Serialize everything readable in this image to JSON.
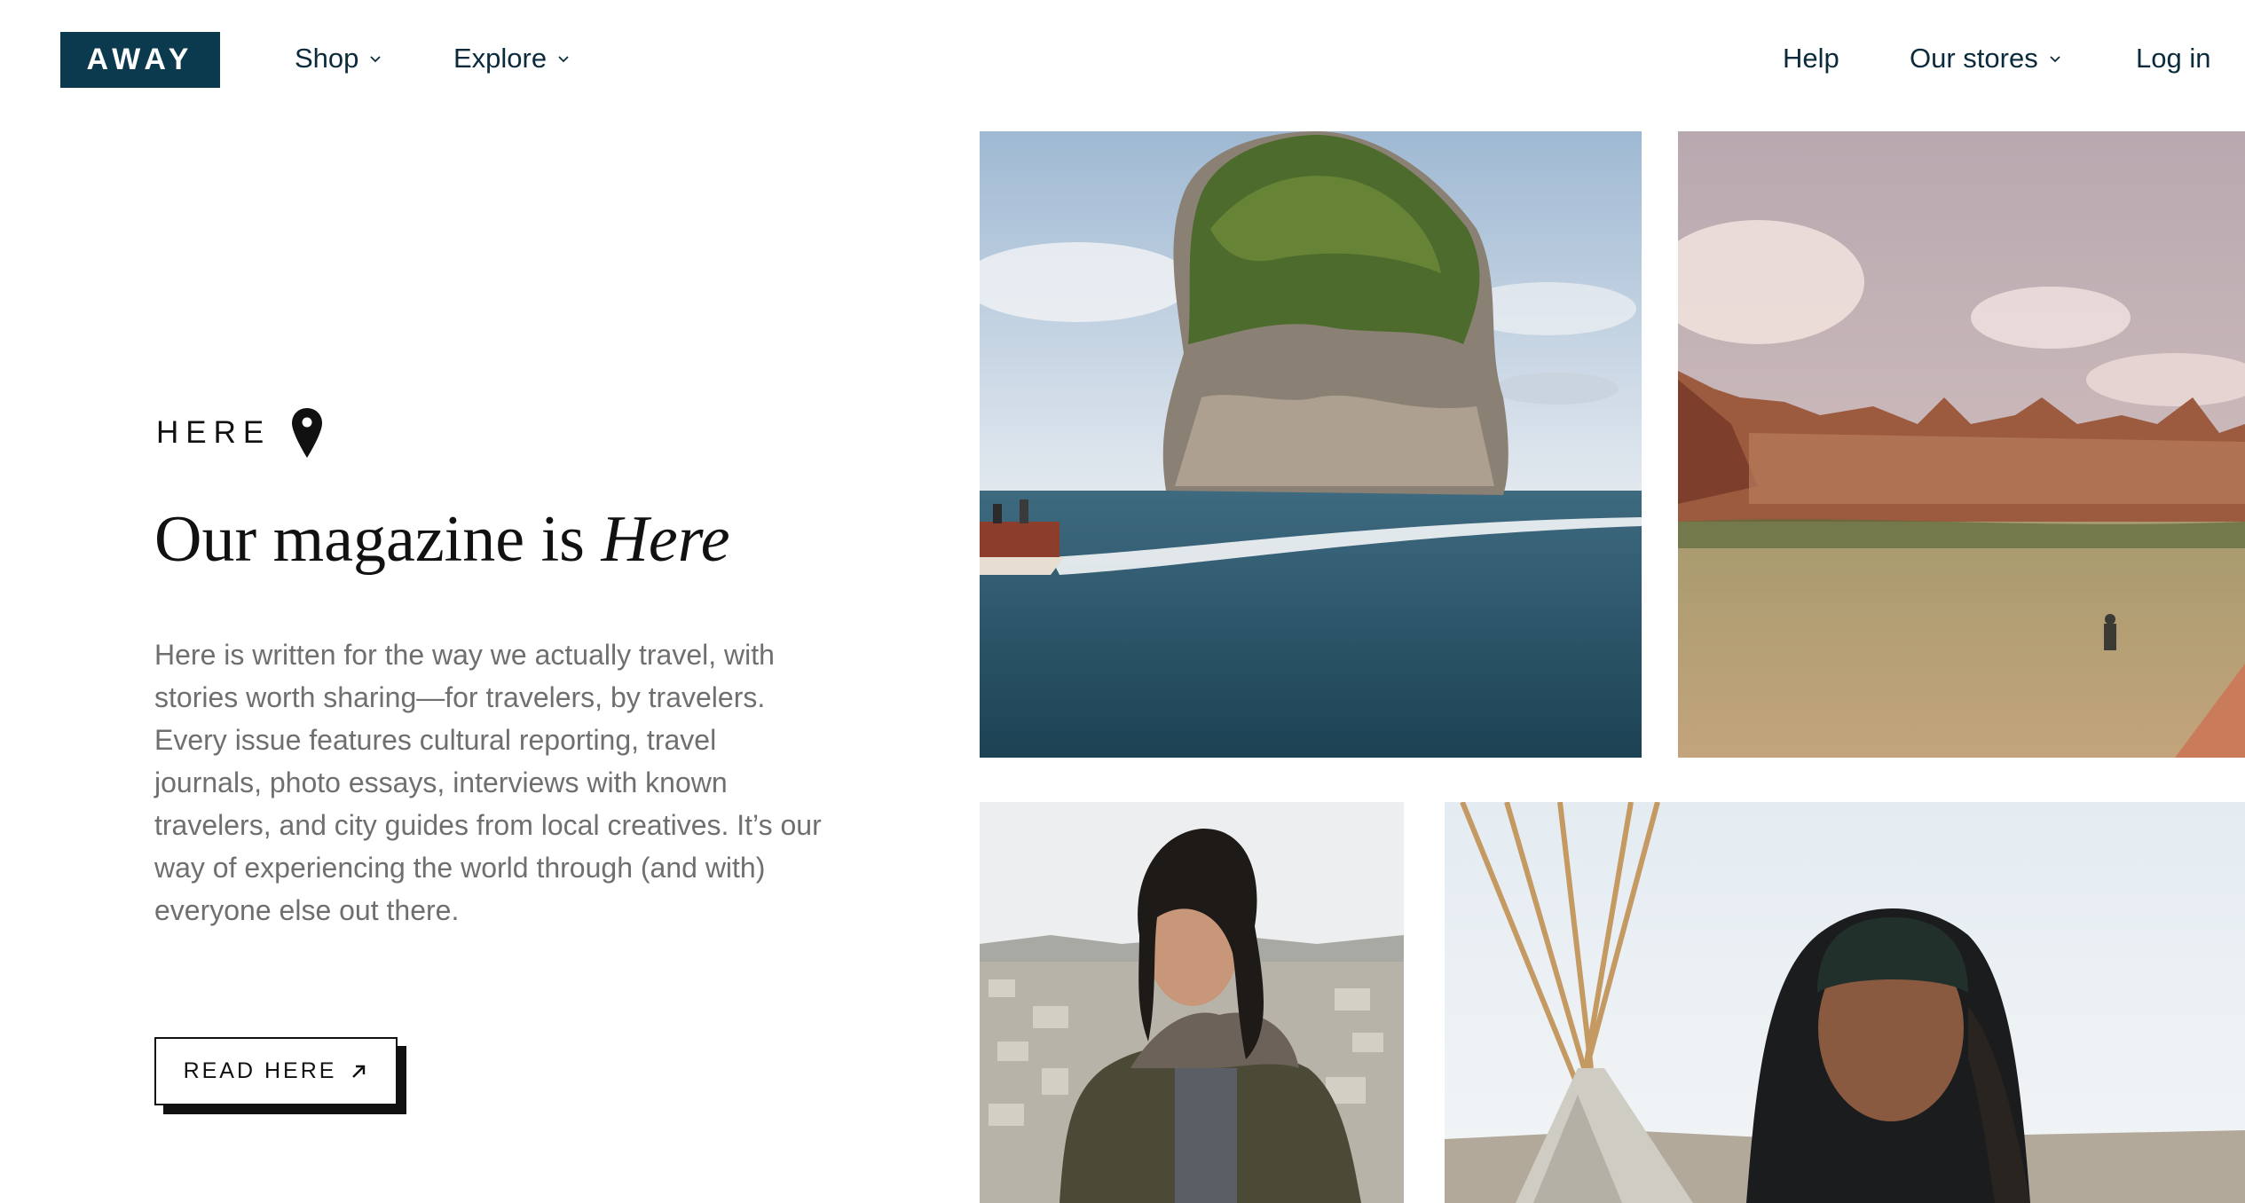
{
  "header": {
    "logo": "AWAY",
    "nav_left": [
      {
        "label": "Shop",
        "icon": "chevron-down-icon"
      },
      {
        "label": "Explore",
        "icon": "chevron-down-icon"
      }
    ],
    "nav_right": [
      {
        "label": "Help"
      },
      {
        "label": "Our stores",
        "icon": "chevron-down-icon"
      },
      {
        "label": "Log in"
      }
    ]
  },
  "hero": {
    "eyebrow": "HERE",
    "eyebrow_icon": "map-pin-icon",
    "headline_prefix": "Our magazine is ",
    "headline_italic": "Here",
    "body": "Here is written for the way we actually travel, with stories worth sharing—for travelers, by travelers. Every issue features cultural reporting, travel journals, photo essays, interviews with known travelers, and city guides from local creatives. It’s our way of experiencing the world through (and with) everyone else out there.",
    "cta_label": "READ HERE",
    "cta_icon": "arrow-up-right-icon"
  },
  "photos": [
    {
      "name": "island-rock-photo"
    },
    {
      "name": "desert-canyon-photo"
    },
    {
      "name": "woman-city-view-photo"
    },
    {
      "name": "man-hooded-teepee-photo"
    }
  ],
  "colors": {
    "brand_navy": "#0b3a4e",
    "text_dark": "#0b2a3c",
    "body_gray": "#6f6f6f",
    "background": "#ffffff"
  }
}
